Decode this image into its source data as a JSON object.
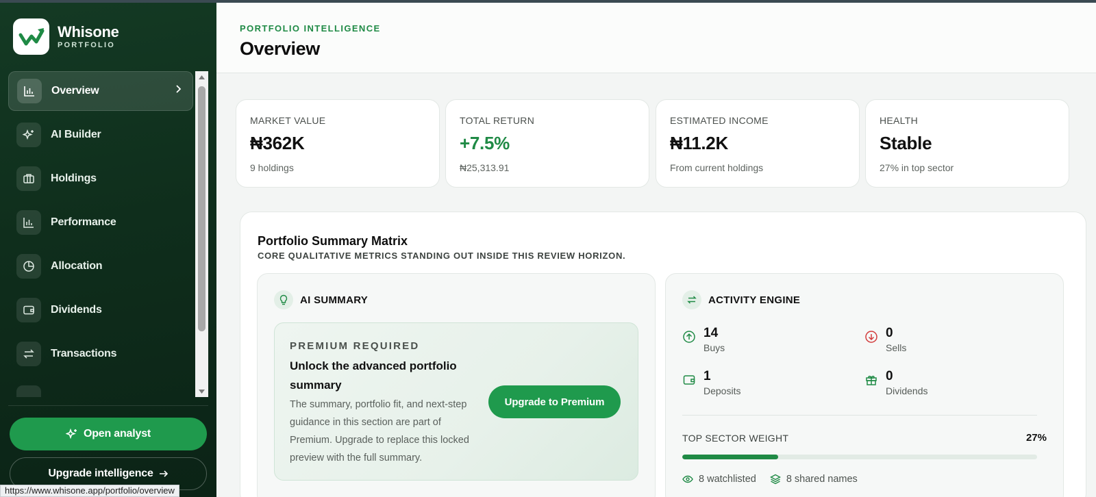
{
  "brand": {
    "name": "Whisone",
    "sub": "PORTFOLIO"
  },
  "nav": {
    "items": [
      {
        "label": "Overview",
        "icon": "bar-chart-icon",
        "active": true
      },
      {
        "label": "AI Builder",
        "icon": "sparkles-icon"
      },
      {
        "label": "Holdings",
        "icon": "briefcase-icon"
      },
      {
        "label": "Performance",
        "icon": "bar-chart-icon"
      },
      {
        "label": "Allocation",
        "icon": "pie-chart-icon"
      },
      {
        "label": "Dividends",
        "icon": "wallet-icon"
      },
      {
        "label": "Transactions",
        "icon": "swap-icon"
      }
    ]
  },
  "sidebar_actions": {
    "analyst": "Open analyst",
    "upgrade": "Upgrade intelligence"
  },
  "status_url": "https://www.whisone.app/portfolio/overview",
  "header": {
    "eyebrow": "PORTFOLIO INTELLIGENCE",
    "title": "Overview"
  },
  "stats": [
    {
      "label": "MARKET VALUE",
      "value": "₦362K",
      "sub": "9 holdings"
    },
    {
      "label": "TOTAL RETURN",
      "value": "+7.5%",
      "sub": "₦25,313.91",
      "value_color": "#1f8a45"
    },
    {
      "label": "ESTIMATED INCOME",
      "value": "₦11.2K",
      "sub": "From current holdings"
    },
    {
      "label": "HEALTH",
      "value": "Stable",
      "sub": "27% in top sector"
    }
  ],
  "matrix": {
    "title": "Portfolio Summary Matrix",
    "subtitle": "CORE QUALITATIVE METRICS STANDING OUT INSIDE THIS REVIEW HORIZON."
  },
  "ai_summary": {
    "title": "AI SUMMARY",
    "premium_label": "PREMIUM REQUIRED",
    "premium_title": "Unlock the advanced portfolio summary",
    "premium_body": "The summary, portfolio fit, and next-step guidance in this section are part of Premium. Upgrade to replace this locked preview with the full summary.",
    "cta": "Upgrade to Premium"
  },
  "activity": {
    "title": "ACTIVITY ENGINE",
    "items": [
      {
        "value": "14",
        "label": "Buys",
        "icon": "arrow-up-circle-icon",
        "color": "#1f8a45"
      },
      {
        "value": "0",
        "label": "Sells",
        "icon": "arrow-down-circle-icon",
        "color": "#d23b3b"
      },
      {
        "value": "1",
        "label": "Deposits",
        "icon": "wallet-icon",
        "color": "#1f8a45"
      },
      {
        "value": "0",
        "label": "Dividends",
        "icon": "gift-icon",
        "color": "#1f8a45"
      }
    ],
    "sector_label": "TOP SECTOR WEIGHT",
    "sector_value": "27%",
    "sector_fraction": 0.27,
    "watchlisted": "8 watchlisted",
    "shared": "8 shared names"
  },
  "colors": {
    "accent": "#1f9a4d",
    "sidebar": "#0f2e1c",
    "negative": "#d23b3b"
  }
}
